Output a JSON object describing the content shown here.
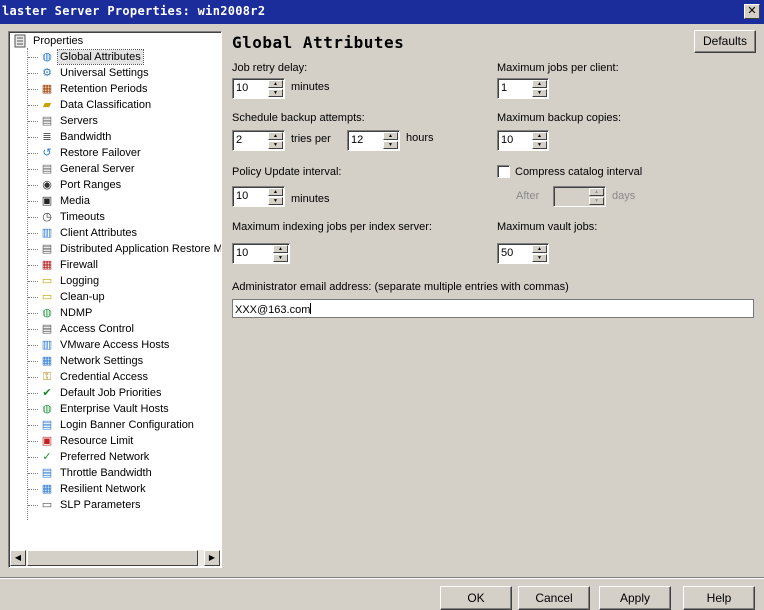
{
  "window": {
    "title": "laster Server Properties: win2008r2"
  },
  "tree": {
    "root": "Properties",
    "items": [
      {
        "label": "Global Attributes",
        "icon": "globe-icon",
        "selected": true
      },
      {
        "label": "Universal Settings",
        "icon": "settings-globe-icon"
      },
      {
        "label": "Retention Periods",
        "icon": "calendar-clock-icon"
      },
      {
        "label": "Data Classification",
        "icon": "folder-tag-icon"
      },
      {
        "label": "Servers",
        "icon": "server-icon"
      },
      {
        "label": "Bandwidth",
        "icon": "bandwidth-icon"
      },
      {
        "label": "Restore Failover",
        "icon": "restore-failover-icon"
      },
      {
        "label": "General Server",
        "icon": "server-icon"
      },
      {
        "label": "Port Ranges",
        "icon": "port-icon"
      },
      {
        "label": "Media",
        "icon": "media-tape-icon"
      },
      {
        "label": "Timeouts",
        "icon": "clock-icon"
      },
      {
        "label": "Client Attributes",
        "icon": "client-icon"
      },
      {
        "label": "Distributed Application Restore Map",
        "icon": "app-map-icon"
      },
      {
        "label": "Firewall",
        "icon": "firewall-icon"
      },
      {
        "label": "Logging",
        "icon": "log-folder-icon"
      },
      {
        "label": "Clean-up",
        "icon": "cleanup-folder-icon"
      },
      {
        "label": "NDMP",
        "icon": "ndmp-globe-icon"
      },
      {
        "label": "Access Control",
        "icon": "access-control-icon"
      },
      {
        "label": "VMware Access Hosts",
        "icon": "vmware-host-icon"
      },
      {
        "label": "Network Settings",
        "icon": "network-icon"
      },
      {
        "label": "Credential Access",
        "icon": "key-icon"
      },
      {
        "label": "Default Job Priorities",
        "icon": "priority-check-icon"
      },
      {
        "label": "Enterprise Vault Hosts",
        "icon": "vault-globe-icon"
      },
      {
        "label": "Login Banner Configuration",
        "icon": "login-banner-icon"
      },
      {
        "label": "Resource Limit",
        "icon": "resource-limit-icon"
      },
      {
        "label": "Preferred Network",
        "icon": "preferred-network-icon"
      },
      {
        "label": "Throttle Bandwidth",
        "icon": "throttle-icon"
      },
      {
        "label": "Resilient Network",
        "icon": "resilient-network-icon"
      },
      {
        "label": "SLP Parameters",
        "icon": "slp-doc-icon"
      }
    ]
  },
  "main": {
    "title": "Global Attributes",
    "defaults_label": "Defaults",
    "job_retry_delay": {
      "label": "Job retry delay:",
      "value": "10",
      "unit": "minutes"
    },
    "schedule_backup_attempts": {
      "label": "Schedule backup attempts:",
      "tries_value": "2",
      "tries_unit": "tries per",
      "hours_value": "12",
      "hours_unit": "hours"
    },
    "policy_update_interval": {
      "label": "Policy Update interval:",
      "value": "10",
      "unit": "minutes"
    },
    "max_indexing_jobs": {
      "label": "Maximum indexing jobs per index server:",
      "value": "10"
    },
    "max_jobs_per_client": {
      "label": "Maximum jobs per client:",
      "value": "1"
    },
    "max_backup_copies": {
      "label": "Maximum backup copies:",
      "value": "10"
    },
    "compress_catalog": {
      "label": "Compress catalog interval",
      "checked": false,
      "after_label": "After",
      "value": "",
      "unit": "days"
    },
    "max_vault_jobs": {
      "label": "Maximum vault jobs:",
      "value": "50"
    },
    "admin_email": {
      "label": "Administrator email address: (separate multiple entries with commas)",
      "value": "XXX@163.com"
    }
  },
  "footer": {
    "ok": "OK",
    "cancel": "Cancel",
    "apply": "Apply",
    "help": "Help"
  }
}
